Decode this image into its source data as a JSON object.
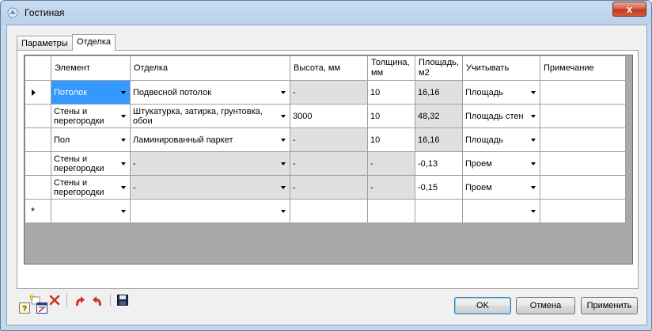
{
  "window": {
    "title": "Гостиная",
    "close_label": "x"
  },
  "tabs": [
    {
      "label": "Параметры",
      "active": false
    },
    {
      "label": "Отделка",
      "active": true
    }
  ],
  "grid": {
    "columns": [
      "Элемент",
      "Отделка",
      "Высота, мм",
      "Толщина, мм",
      "Площадь, м2",
      "Учитывать",
      "Примечание"
    ],
    "rows": [
      {
        "element": "Потолок",
        "finish": "Подвесной потолок",
        "height": "-",
        "thickness": "10",
        "area": "16,16",
        "consider": "Площадь",
        "note": ""
      },
      {
        "element": "Стены и перегородки",
        "finish": "Штукатурка, затирка, грунтовка, обои",
        "height": "3000",
        "thickness": "10",
        "area": "48,32",
        "consider": "Площадь стен",
        "note": ""
      },
      {
        "element": "Пол",
        "finish": "Ламинированный паркет",
        "height": "-",
        "thickness": "10",
        "area": "16,16",
        "consider": "Площадь",
        "note": ""
      },
      {
        "element": "Стены и перегородки",
        "finish": "-",
        "height": "-",
        "thickness": "-",
        "area": "-0,13",
        "consider": "Проем",
        "note": ""
      },
      {
        "element": "Стены и перегородки",
        "finish": "-",
        "height": "-",
        "thickness": "-",
        "area": "-0,15",
        "consider": "Проем",
        "note": ""
      }
    ],
    "new_row_marker": "*"
  },
  "buttons": {
    "ok": "OK",
    "cancel": "Отмена",
    "apply": "Применить"
  },
  "icons": [
    "new-row-icon",
    "delete-icon",
    "move-up-icon",
    "move-down-icon",
    "save-icon",
    "help-icon",
    "drawing-icon"
  ]
}
